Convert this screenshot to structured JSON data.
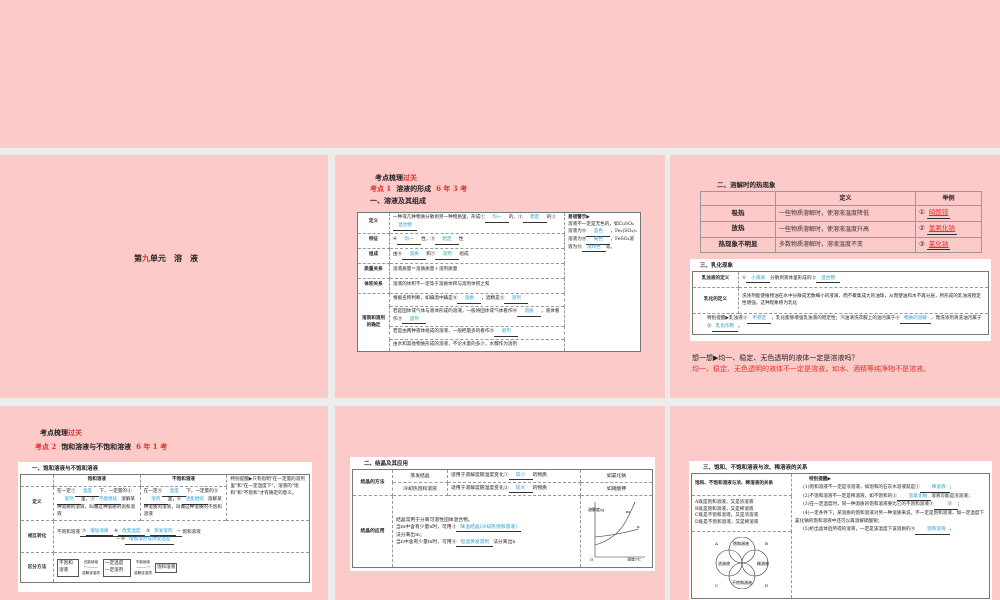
{
  "slide1": {
    "title_a": "第",
    "title_red": "九",
    "title_b": "单元　溶　液"
  },
  "slide2": {
    "header_a": "考点梳理",
    "header_red": "过关",
    "kp_red": "考点 1",
    "kp_title": "溶液的形成",
    "kp_count": "6 年 3 考",
    "section": "一、溶液及其组成",
    "rows": [
      {
        "k": "定义",
        "v": "一种或几种物质分散到另一种物质里，形成①",
        "b1": "均一",
        "m": "的、②",
        "b2": "稳定",
        "e": "的③",
        "b3": "混合物"
      },
      {
        "k": "特征",
        "v": "④",
        "b1": "均一",
        "m": "性，⑤",
        "b2": "稳定",
        "e": "性"
      },
      {
        "k": "组成",
        "v": "由⑥",
        "b1": "溶质",
        "m": "和⑦",
        "b2": "溶剂",
        "e": "组成"
      },
      {
        "k": "质量关系",
        "v": "溶液质量＝溶质质量＋溶剂质量"
      },
      {
        "k": "体积关系",
        "v": "溶液的体积不一定等于溶质体积与溶剂体积之和"
      }
    ],
    "det_key": "溶质和溶剂的确定",
    "det": [
      {
        "v": "根据名称判断，如碘酒中碘是⑧",
        "b1": "溶质",
        "m": "，酒精是⑨",
        "b2": "溶剂"
      },
      {
        "v": "若是固体或气体与液体形成的溶液，一般将固体或气体看作⑩",
        "b1": "溶质",
        "m": "，液体看作⑪",
        "b2": "溶剂"
      },
      {
        "v": "若是由两种液体组成的溶液，一般把量多的看作⑫",
        "b1": "溶剂"
      },
      {
        "v": "由水和其他物质形成的溶液，不论水量的多少，水都作为溶剂"
      }
    ],
    "note_title": "易错警示▶",
    "note_a": "溶液不一定是无色的，如CuSO₄溶液为⑬",
    "note_b1": "蓝色",
    "note_b": "，Fe₂(SO₄)₃溶液为⑭",
    "note_b2": "黄色",
    "note_c": "，FeSO₄溶液为⑮",
    "note_b3": "浅绿色",
    "note_d": "等。"
  },
  "slide3": {
    "section": "二、溶解时的热现象",
    "head": [
      "",
      "定义",
      "举例"
    ],
    "rows": [
      {
        "k": "吸热",
        "d": "一些物质溶解时，使溶液温度降低",
        "n": "①",
        "ex": "硝酸铵"
      },
      {
        "k": "放热",
        "d": "一些物质溶解时，使溶液温度升高",
        "n": "②",
        "ex": "氢氧化钠"
      },
      {
        "k": "热现象不明显",
        "d": "多数物质溶解时，溶液温度不变",
        "n": "③",
        "ex": "氯化钠"
      }
    ],
    "emul_cap": "三、乳化现象",
    "emul_k1": "乳浊液的定义",
    "emul_v1a": "①",
    "emul_b1": "小液滴",
    "emul_v1b": "分散到液体里形成的②",
    "emul_b2": "混合物",
    "emul_k2": "乳化的定义",
    "emul_v2": "洗涤剂能使植物油在水中分散成无数细小的液滴，而不聚集成大的油珠，从而使油和水不再分层，所形成的乳浊液稳定性增强，这种现象称为乳化",
    "tip_a": "特别提醒▶乳浊液③",
    "tip_b1": "不稳定",
    "tip_b": "，乳化能够增强乳浊液的稳定性；汽油清洗衣服上的油污属于④",
    "tip_b2": "物质的溶解",
    "tip_c": "，而洗涤剂清洗油污属于⑤",
    "tip_b3": "乳化作用",
    "tip_d": "。",
    "think_q": "想一想▶均一、稳定、无色透明的液体一定是溶液吗？",
    "think_a": "均一、稳定、无色透明的液体不一定是溶液，如水、酒精等纯净物不是溶液。"
  },
  "slide4": {
    "header_a": "考点梳理",
    "header_red": "过关",
    "kp_red": "考点 2",
    "kp_title": "饱和溶液与不饱和溶液",
    "kp_count": "6 年 1 考",
    "cap": "一、饱和溶液与不饱和溶液",
    "head": [
      "",
      "饱和溶液",
      "不饱和溶液"
    ],
    "def_k": "定义",
    "sat": {
      "a": "在一定①",
      "b1": "温度",
      "b": "下，一定量的②",
      "b2": "溶剂",
      "c": "里，③",
      "b3": "不能继续",
      "d": "溶解某种溶质的溶液，叫做这种溶质的饱和溶液"
    },
    "unsat": {
      "a": "在一定④",
      "b1": "温度",
      "b": "下，一定量的⑤",
      "b2": "溶剂",
      "c": "里，⑥",
      "b3": "还能继续",
      "d": "溶解某种溶质的溶液，叫做这种溶质的不饱和溶液"
    },
    "tip": "特别提醒▶只有指明\"在一定量的溶剂里\"和\"在一定温度下\"，溶液的\"饱和\"和\"不饱和\"才有确定的意义。",
    "conv_k": "相互转化",
    "conv_from": "不饱和溶液",
    "c1n": "⑦",
    "c1": "增加溶质",
    "c2n": "⑧",
    "c2": "改变温度",
    "c3n": "⑨",
    "c3": "蒸发溶剂",
    "c4n": "⑩",
    "c4": "增加溶剂或改变温度",
    "conv_to": "饱和溶液",
    "dist_k": "区分方法",
    "d_unsat": "不饱和溶液",
    "d_arrow1a": "还能继续",
    "d_arrow1b": "溶解该溶质",
    "d_mid_a": "一定温度",
    "d_mid_b": "一定溶剂",
    "d_arrow2a": "不能继续",
    "d_arrow2b": "溶解该溶质",
    "d_sat": "饱和溶液"
  },
  "slide5": {
    "cap": "二、结晶及其应用",
    "method_k": "结晶的方法",
    "m1": "蒸发结晶",
    "m1d": "适用于溶解度随温度变化①",
    "m1b": "较小",
    "m1e": "的物质",
    "m1x": "如氯化钠",
    "m2": "冷却热饱和溶液",
    "m2d": "适用于溶解度随温度变化②",
    "m2b": "较大",
    "m2e": "的物质",
    "m2x": "如硝酸钾",
    "app_k": "结晶的应用",
    "app_a": "结晶常用于分离可溶性固体混合物。",
    "app_b": "当m中含有少量n时，可用③",
    "app_b1": "降温结晶(冷却热饱和溶液)",
    "app_c": "法分离出m；",
    "app_d": "当n中含有少量m时，可用④",
    "app_b2": "恒温蒸发溶剂",
    "app_e": "法分离出n",
    "graph": {
      "ylabel": "溶解度/g",
      "xlabel": "温度/℃",
      "origin": "O",
      "m": "m",
      "n": "n"
    }
  },
  "slide6": {
    "cap": "三、饱和、不饱和溶液与浓、稀溶液的关系",
    "left_title": "饱和、不饱和溶液与浓、稀溶液的关系",
    "items": [
      "A既是饱和溶液，又是浓溶液",
      "B既是饱和溶液，又是稀溶液",
      "C既是不饱和溶液，又是浓溶液",
      "D既是不饱和溶液，又是稀溶液"
    ],
    "venn": {
      "top": "饱和溶液",
      "bottom": "不饱和溶液",
      "left": "浓溶液",
      "right": "稀溶液",
      "A": "A",
      "B": "B",
      "C": "C",
      "D": "D"
    },
    "tip_title": "特别提醒▶",
    "t1": "(1)饱和溶液不一定是浓溶液，如饱和的石灰水溶液就是①",
    "t1b": "稀溶液",
    "t1e": "；",
    "t2": "(2)不饱和溶液不一定是稀溶液，如不饱和的②",
    "t2b": "氢氧化钠",
    "t2e": "溶液可能是浓溶液；",
    "t3": "(3)在一定温度时，同一种溶质的饱和溶液要比它的不饱和溶液③",
    "t3b": "浓",
    "t3e": "；",
    "t4": "(4)一定条件下，某溶质的饱和溶液对另一种溶质来说，不一定是饱和溶液，如一定温度下氯化钠的饱和溶液中还可以再溶解硫酸铜；",
    "t5": "(5)析出晶体后所得的溶液，一定是该温度下该溶质的④",
    "t5b": "饱和溶液",
    "t5e": "。"
  },
  "colors": {
    "slide_bg": "#fdcaca",
    "red": "#e5302b",
    "blue": "#2a9fd0"
  }
}
